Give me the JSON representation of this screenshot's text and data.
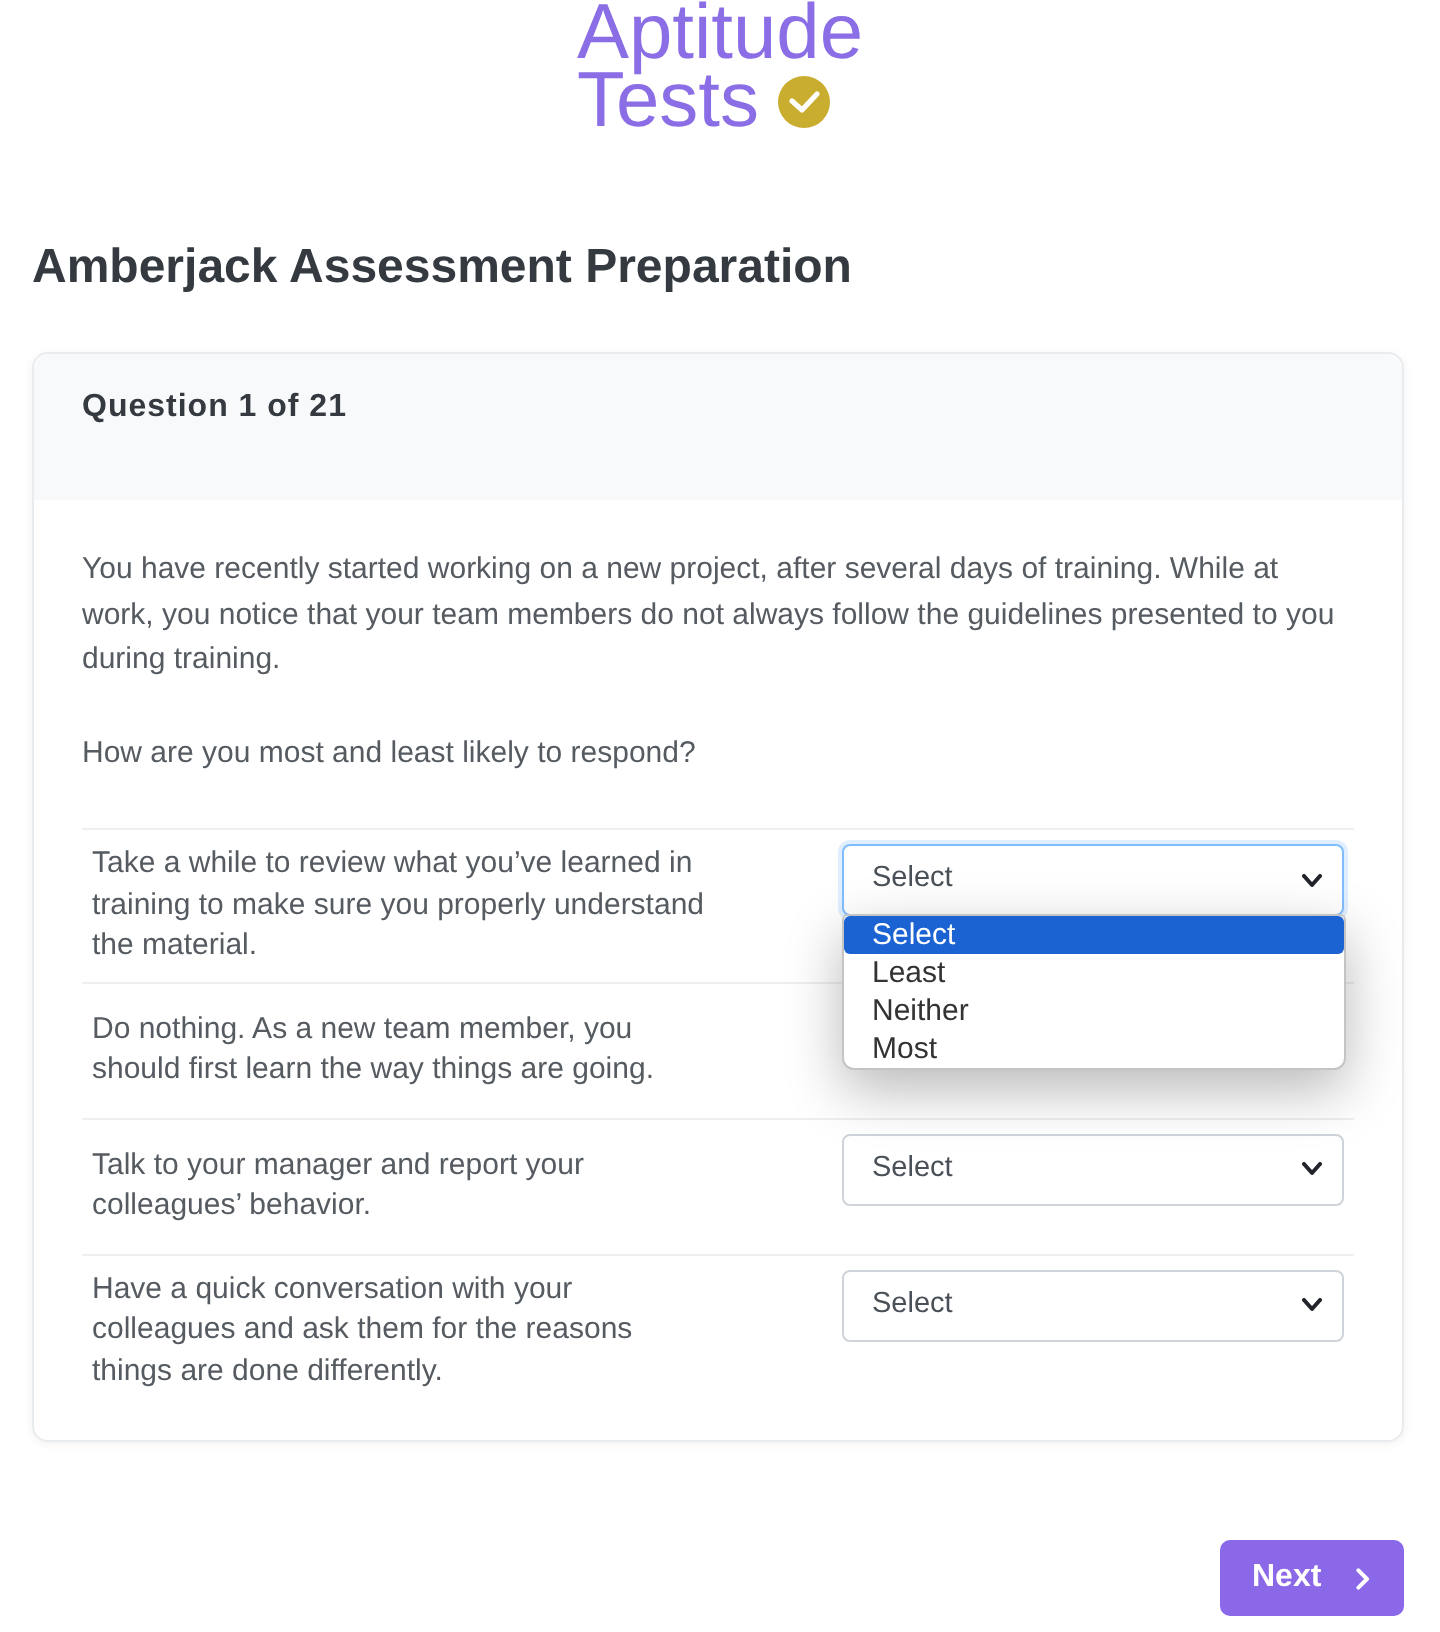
{
  "logo": {
    "lines": [
      "Aptitude",
      "Tests"
    ]
  },
  "title": "Amberjack Assessment Preparation",
  "question": {
    "header": "Question 1 of 21",
    "paragraphs": [
      "You have recently started working on a new project, after several days of training. While at work, you notice that your team members do not always follow the guidelines presented to you during training.",
      "How are you most and least likely to respond?"
    ],
    "responses": [
      {
        "text": "Take a while to review what you’ve learned in training to make sure you properly understand the material.",
        "select": {
          "value": "Select",
          "focused": true,
          "expanded": true,
          "options": [
            {
              "label": "Select",
              "selected": true
            },
            {
              "label": "Least",
              "selected": false
            },
            {
              "label": "Neither",
              "selected": false
            },
            {
              "label": "Most",
              "selected": false
            }
          ]
        }
      },
      {
        "text": "Do nothing. As a new team member, you should first learn the way things are going."
      },
      {
        "text": "Talk to your manager and report your colleagues’ behavior.",
        "select": {
          "value": "Select",
          "focused": false,
          "expanded": false
        }
      },
      {
        "text": "Have a quick conversation with your colleagues and ask them for the reasons things are done differently.",
        "select": {
          "value": "Select",
          "focused": false,
          "expanded": false
        }
      }
    ]
  },
  "next_button": {
    "label": "Next"
  }
}
